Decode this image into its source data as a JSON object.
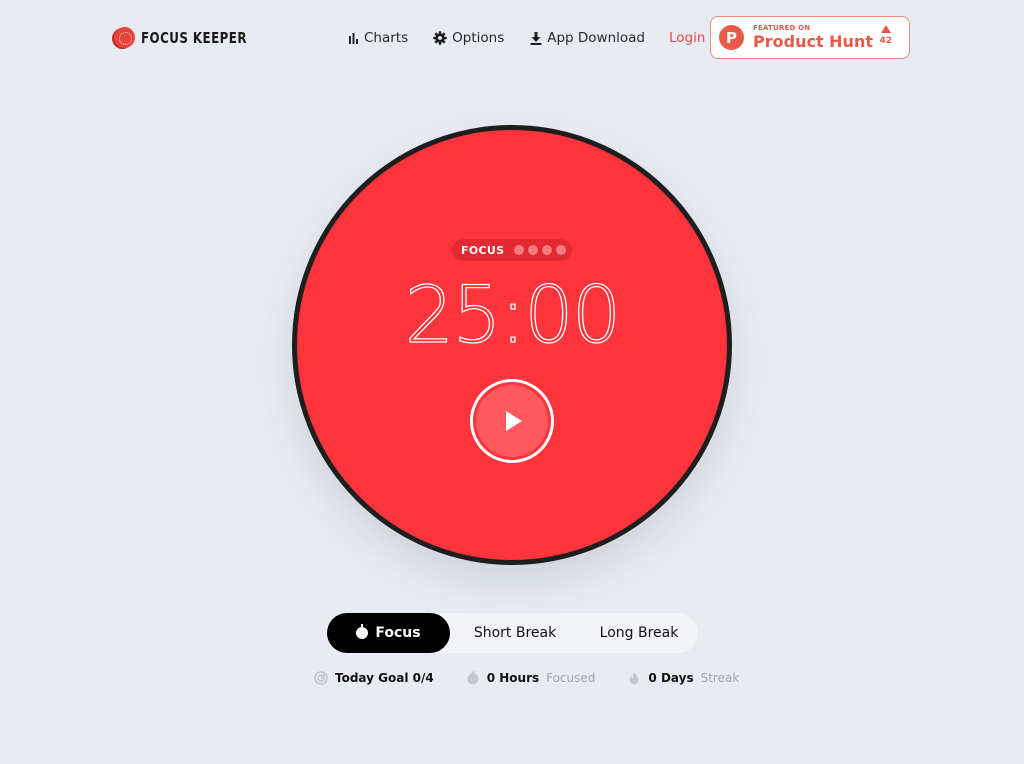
{
  "header": {
    "logo_text": "FOCUS KEEPER",
    "nav": [
      {
        "label": "Charts",
        "icon": "bar-chart-icon"
      },
      {
        "label": "Options",
        "icon": "gear-icon"
      },
      {
        "label": "App Download",
        "icon": "download-icon"
      }
    ],
    "login_label": "Login",
    "product_hunt": {
      "small_text": "FEATURED ON",
      "big_text": "Product Hunt",
      "logo_letter": "P",
      "votes": "42"
    }
  },
  "timer": {
    "mode_label": "FOCUS",
    "sessions_total": 4,
    "sessions_done": 0,
    "time": "25:00",
    "play_label": "Start timer"
  },
  "modes": {
    "items": [
      {
        "label": "Focus",
        "active": true
      },
      {
        "label": "Short Break",
        "active": false
      },
      {
        "label": "Long Break",
        "active": false
      }
    ]
  },
  "stats": {
    "goal": {
      "label": "Today Goal 0/4"
    },
    "hours": {
      "value": "0 Hours",
      "suffix": "Focused"
    },
    "streak": {
      "value": "0 Days",
      "suffix": "Streak"
    }
  },
  "colors": {
    "background": "#e8ebf2",
    "timer_red": "#fd343c",
    "accent_red": "#e84b46",
    "product_hunt": "#e8594a"
  }
}
